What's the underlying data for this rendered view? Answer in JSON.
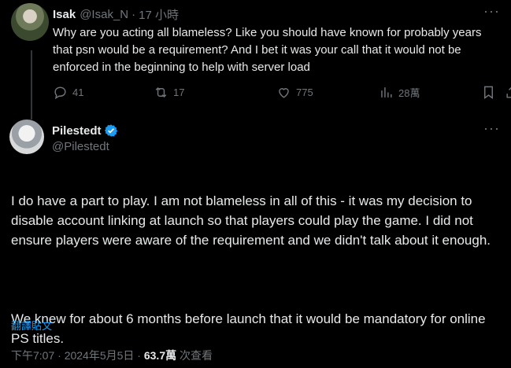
{
  "reply_tweet": {
    "display_name": "Isak",
    "handle": "@Isak_N",
    "separator": "·",
    "time": "17 小時",
    "text": "Why are you acting all blameless? Like you should have known for probably years that psn would be a requirement? And I bet it was your call that it would not be enforced in the beginning to help with server load",
    "actions": {
      "replies": "41",
      "reposts": "17",
      "likes": "775",
      "views": "28萬"
    },
    "icons": [
      "more-icon",
      "reply-icon",
      "repost-icon",
      "like-icon",
      "views-icon",
      "bookmark-icon",
      "share-icon"
    ]
  },
  "main_tweet": {
    "display_name": "Pilestedt",
    "handle": "@Pilestedt",
    "verified_color": "#1d9bf0",
    "paragraph1": "I do have a part to play. I am not blameless in all of this - it was my decision to disable account linking at launch so that players could play the game. I did not ensure players were aware of the requirement and we didn't talk about it enough.",
    "paragraph2": "We knew for about 6 months before launch that it would be mandatory for online PS titles.",
    "translate_label": "翻譯貼文",
    "timestamp": "下午7:07 · 2024年5月5日 · ",
    "views_count": "63.7萬",
    "views_label": " 次查看"
  },
  "colors": {
    "background": "#000000",
    "text": "#e7e9ea",
    "muted": "#71767b",
    "accent": "#1d9bf0"
  }
}
